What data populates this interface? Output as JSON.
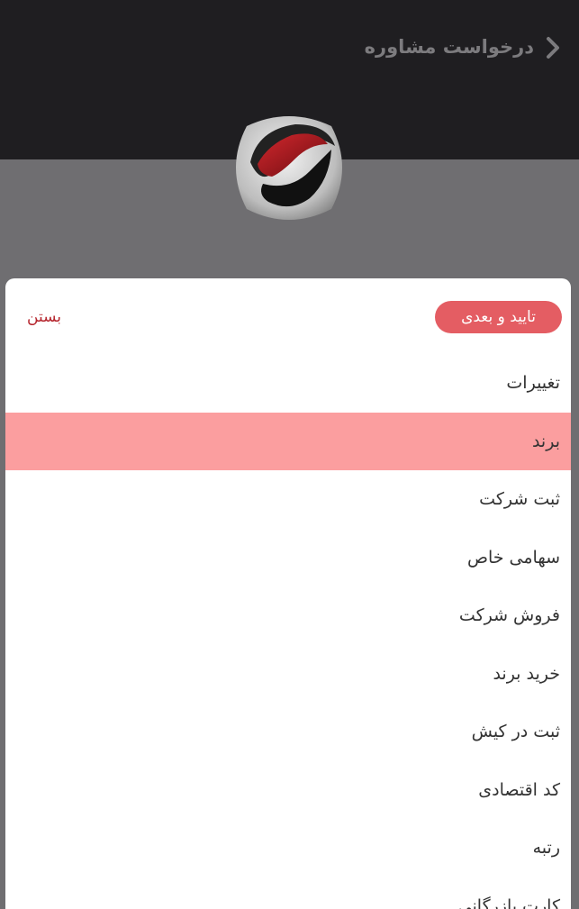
{
  "header": {
    "title": "درخواست مشاوره",
    "colors": {
      "background": "#1f1e21",
      "title": "#7c7b7e"
    }
  },
  "logo": {
    "icon": "brand-logo-icon"
  },
  "sheet": {
    "confirm_label": "تایید و بعدی",
    "close_label": "بستن",
    "colors": {
      "confirm": "#e45d63",
      "close": "#b5242c",
      "selected_row": "#fb9e9f"
    },
    "selected_index": 1,
    "items": [
      {
        "label": "تغییرات"
      },
      {
        "label": "برند"
      },
      {
        "label": "ثبت شرکت"
      },
      {
        "label": "سهامی خاص"
      },
      {
        "label": "فروش شرکت"
      },
      {
        "label": "خرید برند"
      },
      {
        "label": "ثبت در کیش"
      },
      {
        "label": "کد اقتصادی"
      },
      {
        "label": "رتبه"
      },
      {
        "label": "کارت بازرگانی"
      }
    ]
  }
}
